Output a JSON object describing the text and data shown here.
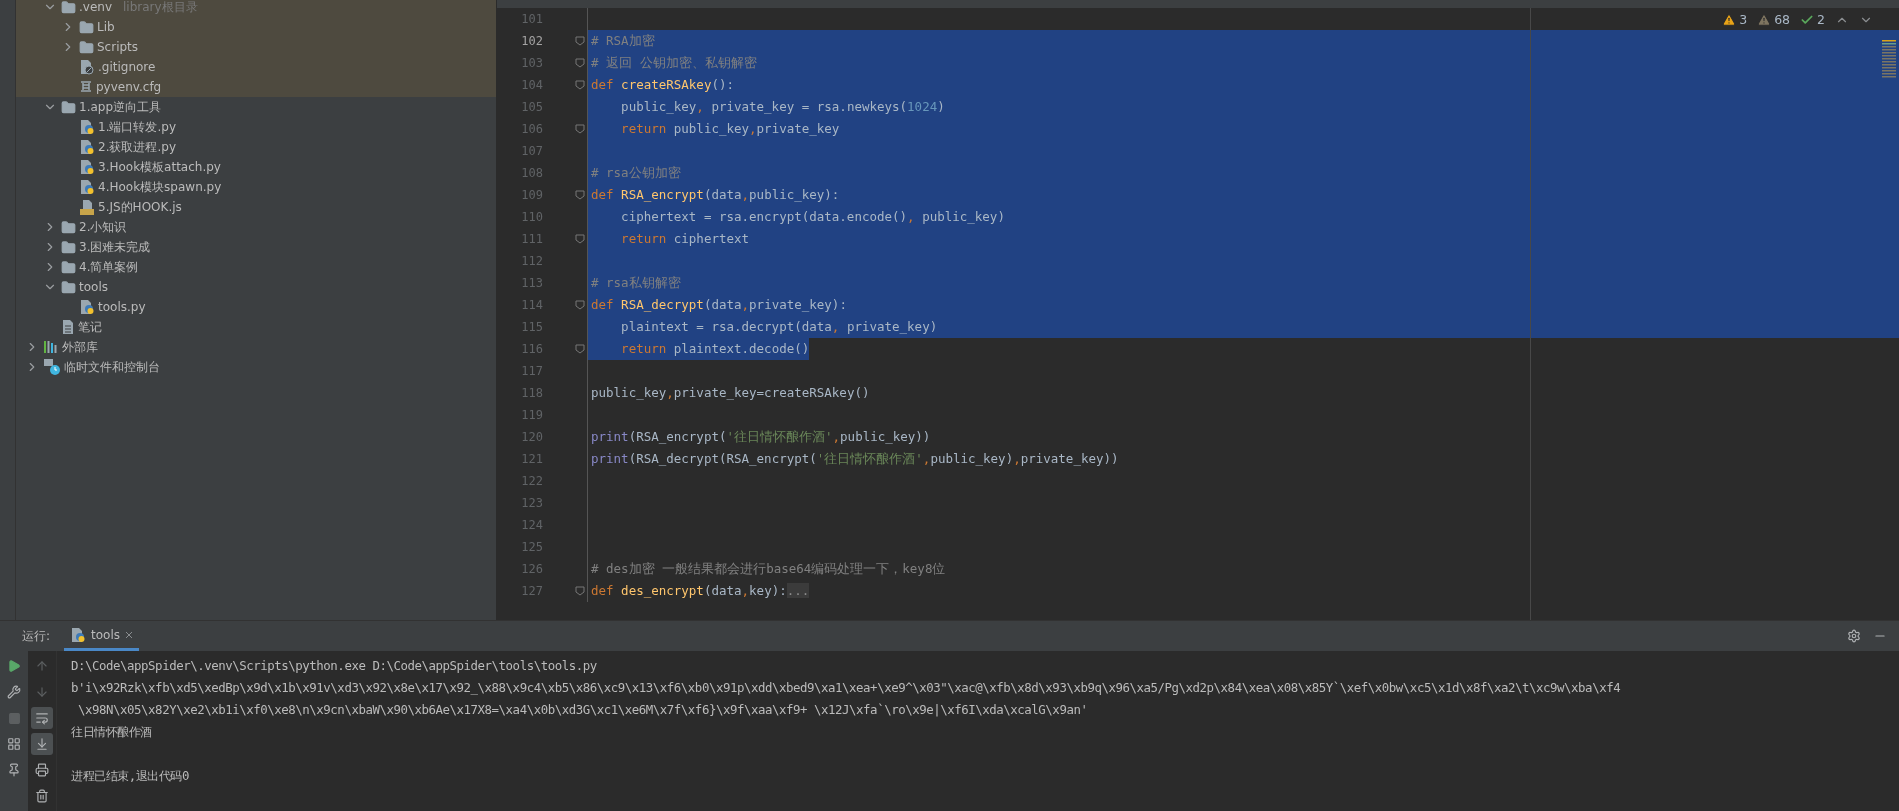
{
  "project_tree": [
    {
      "label": ".venv",
      "hint": "library根目录",
      "kind": "folder",
      "expanded": true,
      "highlighted": true,
      "children": [
        {
          "label": "Lib",
          "kind": "folder",
          "expanded": false
        },
        {
          "label": "Scripts",
          "kind": "folder",
          "expanded": false
        },
        {
          "label": ".gitignore",
          "kind": "ignore-file"
        },
        {
          "label": "pyvenv.cfg",
          "kind": "config-file"
        }
      ]
    },
    {
      "label": "1.app逆向工具",
      "kind": "folder",
      "expanded": true,
      "children": [
        {
          "label": "1.端口转发.py",
          "kind": "python-file"
        },
        {
          "label": "2.获取进程.py",
          "kind": "python-file"
        },
        {
          "label": "3.Hook模板attach.py",
          "kind": "python-file"
        },
        {
          "label": "4.Hook模块spawn.py",
          "kind": "python-file"
        },
        {
          "label": "5.JS的HOOK.js",
          "kind": "js-file"
        }
      ]
    },
    {
      "label": "2.小知识",
      "kind": "folder",
      "expanded": false
    },
    {
      "label": "3.困难未完成",
      "kind": "folder",
      "expanded": false
    },
    {
      "label": "4.简单案例",
      "kind": "folder",
      "expanded": false
    },
    {
      "label": "tools",
      "kind": "folder",
      "expanded": true,
      "children": [
        {
          "label": "tools.py",
          "kind": "python-file"
        }
      ]
    },
    {
      "label": "笔记",
      "kind": "text-file"
    }
  ],
  "root_tree": [
    {
      "label": "外部库",
      "kind": "library",
      "expanded": false
    },
    {
      "label": "临时文件和控制台",
      "kind": "scratch",
      "expanded": false
    }
  ],
  "inspections": [
    {
      "kind": "warning",
      "count": "3"
    },
    {
      "kind": "weak",
      "count": "68"
    },
    {
      "kind": "typo",
      "count": "2"
    }
  ],
  "code_lines": [
    {
      "number": "101",
      "current": false,
      "selected": false,
      "fold": false
    },
    {
      "number": "102",
      "current": true,
      "selected": true,
      "partial": false,
      "fold": true,
      "text": "# RSA加密"
    },
    {
      "number": "103",
      "current": false,
      "selected": true,
      "partial": false,
      "fold": true,
      "text": "# 返回 公钥加密、私钥解密"
    },
    {
      "number": "104",
      "current": false,
      "selected": true,
      "partial": false,
      "fold": true,
      "text": "def createRSAkey():"
    },
    {
      "number": "105",
      "current": false,
      "selected": true,
      "partial": false,
      "fold": false,
      "text": "    public_key, private_key = rsa.newkeys(1024)"
    },
    {
      "number": "106",
      "current": false,
      "selected": true,
      "partial": false,
      "fold": true,
      "text": "    return public_key,private_key"
    },
    {
      "number": "107",
      "current": false,
      "selected": true,
      "partial": false,
      "fold": false
    },
    {
      "number": "108",
      "current": false,
      "selected": true,
      "partial": false,
      "fold": false,
      "text": "# rsa公钥加密"
    },
    {
      "number": "109",
      "current": false,
      "selected": true,
      "partial": false,
      "fold": true,
      "text": "def RSA_encrypt(data,public_key):"
    },
    {
      "number": "110",
      "current": false,
      "selected": true,
      "partial": false,
      "fold": false,
      "text": "    ciphertext = rsa.encrypt(data.encode(), public_key)"
    },
    {
      "number": "111",
      "current": false,
      "selected": true,
      "partial": false,
      "fold": true,
      "text": "    return ciphertext"
    },
    {
      "number": "112",
      "current": false,
      "selected": true,
      "partial": false,
      "fold": false
    },
    {
      "number": "113",
      "current": false,
      "selected": true,
      "partial": false,
      "fold": false,
      "text": "# rsa私钥解密"
    },
    {
      "number": "114",
      "current": false,
      "selected": true,
      "partial": false,
      "fold": true,
      "text": "def RSA_decrypt(data,private_key):"
    },
    {
      "number": "115",
      "current": false,
      "selected": true,
      "partial": false,
      "fold": false,
      "text": "    plaintext = rsa.decrypt(data, private_key)"
    },
    {
      "number": "116",
      "current": false,
      "selected": true,
      "partial": true,
      "fold": true,
      "text": "    return plaintext.decode()"
    },
    {
      "number": "117",
      "current": false,
      "selected": false,
      "fold": false
    },
    {
      "number": "118",
      "current": false,
      "selected": false,
      "fold": false,
      "text": "public_key,private_key=createRSAkey()"
    },
    {
      "number": "119",
      "current": false,
      "selected": false,
      "fold": false
    },
    {
      "number": "120",
      "current": false,
      "selected": false,
      "fold": false,
      "text": "print(RSA_encrypt('往日情怀酿作酒',public_key))"
    },
    {
      "number": "121",
      "current": false,
      "selected": false,
      "fold": false,
      "text": "print(RSA_decrypt(RSA_encrypt('往日情怀酿作酒',public_key),private_key))"
    },
    {
      "number": "122",
      "current": false,
      "selected": false,
      "fold": false
    },
    {
      "number": "123",
      "current": false,
      "selected": false,
      "fold": false
    },
    {
      "number": "124",
      "current": false,
      "selected": false,
      "fold": false
    },
    {
      "number": "125",
      "current": false,
      "selected": false,
      "fold": false
    },
    {
      "number": "126",
      "current": false,
      "selected": false,
      "fold": false,
      "text": "# des加密 一般结果都会进行base64编码处理一下，key8位"
    },
    {
      "number": "127",
      "current": false,
      "selected": false,
      "fold": true,
      "text": "def des_encrypt(data,key):..."
    }
  ],
  "run_panel": {
    "label": "运行:",
    "tab": "tools",
    "left_tools": [
      {
        "kind": "run",
        "disabled": false
      },
      {
        "kind": "wrench",
        "disabled": false
      },
      {
        "kind": "stop",
        "disabled": true
      },
      {
        "kind": "layout",
        "disabled": false
      },
      {
        "kind": "pin",
        "disabled": false
      }
    ],
    "right_tools": [
      {
        "kind": "up",
        "on": false
      },
      {
        "kind": "down",
        "on": false
      },
      {
        "kind": "wrap",
        "on": true
      },
      {
        "kind": "scroll",
        "on": true
      },
      {
        "kind": "print",
        "on": false
      },
      {
        "kind": "trash",
        "on": false
      }
    ],
    "output_blocks": [
      [
        "D:\\Code\\appSpider\\.venv\\Scripts\\python.exe D:\\Code\\appSpider\\tools\\tools.py",
        "b'i\\x92Rzk\\xfb\\xd5\\xedBp\\x9d\\x1b\\x91v\\xd3\\x92\\x8e\\x17\\x92_\\x88\\x9c4\\xb5\\x86\\xc9\\x13\\xf6\\xb0\\x91p\\xdd\\xbed9\\xa1\\xea+\\xe9^\\x03\"\\xac@\\xfb\\x8d\\x93\\xb9q\\x96\\xa5/Pg\\xd2p\\x84\\xea\\x08\\x85Y`\\xef\\x0bw\\xc5\\x1d\\x8f\\xa2\\t\\xc9w\\xba\\xf4",
        " \\x98N\\x05\\x82Y\\xe2\\xb1i\\xf0\\xe8\\n\\x9cn\\xbaW\\x90\\xb6Ae\\x17X8=\\xa4\\x0b\\xd3G\\xc1\\xe6M\\x7f\\xf6}\\x9f\\xaa\\xf9+ \\x12J\\xfa`\\ro\\x9e|\\xf6I\\xda\\xcalG\\x9an'",
        "往日情怀酿作酒"
      ],
      [
        "进程已结束,退出代码0"
      ]
    ]
  }
}
